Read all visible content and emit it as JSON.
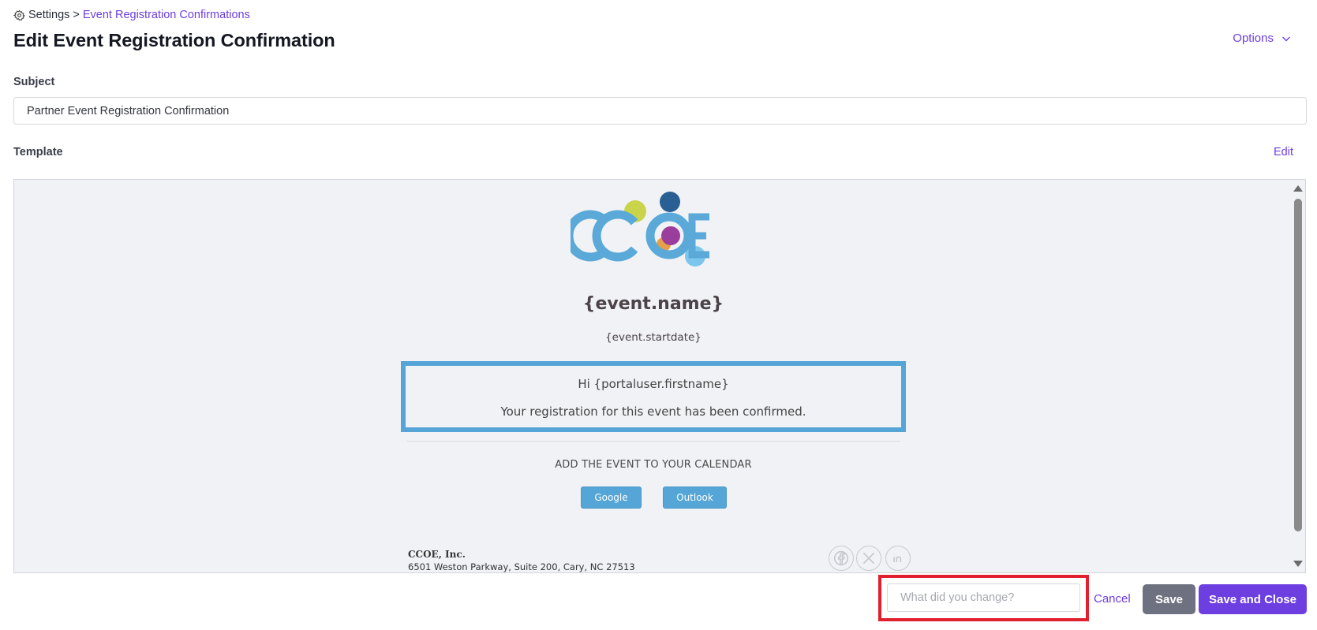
{
  "breadcrumb": {
    "root_icon": "gear-icon",
    "root": "Settings",
    "separator": ">",
    "current": "Event Registration Confirmations"
  },
  "page_title": "Edit Event Registration Confirmation",
  "options": {
    "label": "Options",
    "icon": "chevron-down-icon"
  },
  "subject": {
    "label": "Subject",
    "value": "Partner Event Registration Confirmation"
  },
  "template": {
    "label": "Template",
    "edit_label": "Edit"
  },
  "preview": {
    "logo_text": "CCOE",
    "event_name": "{event.name}",
    "event_startdate": "{event.startdate}",
    "greeting": "Hi {portaluser.firstname}",
    "message": "Your registration for this event has been confirmed.",
    "calendar_heading": "ADD THE EVENT TO YOUR CALENDAR",
    "calendar_buttons": [
      "Google",
      "Outlook"
    ],
    "company_name": "CCOE, Inc.",
    "company_address": "6501 Weston Parkway, Suite 200, Cary, NC 27513",
    "social_icons": [
      "facebook-icon",
      "x-icon",
      "linkedin-icon"
    ]
  },
  "footer": {
    "changes_placeholder": "What did you change?",
    "cancel_label": "Cancel",
    "save_label": "Save",
    "save_close_label": "Save and Close"
  },
  "colors": {
    "accent": "#6d3ee0",
    "preview_blue": "#55a6d6",
    "highlight_red": "#e0202e",
    "save_gray": "#6e7280"
  }
}
